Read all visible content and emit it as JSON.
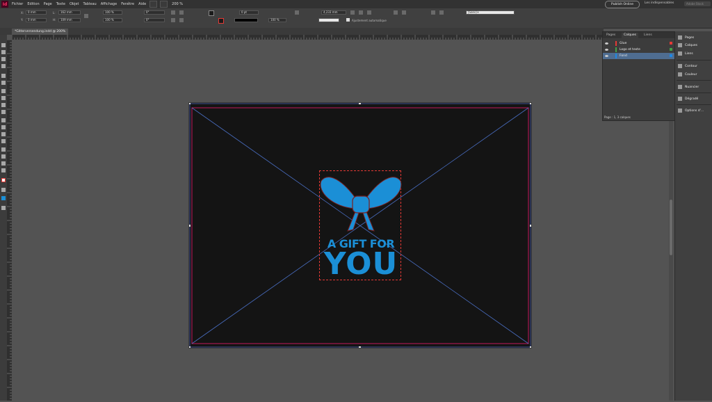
{
  "menubar": {
    "logo": "Id",
    "items": [
      "Fichier",
      "Edition",
      "Page",
      "Texte",
      "Objet",
      "Tableau",
      "Affichage",
      "Fenêtre",
      "Aide"
    ],
    "zoom": "200 %",
    "publish": "Publish Online",
    "workspace": "Les indispensables",
    "search_placeholder": "Adobe Stock"
  },
  "control": {
    "x": "0 mm",
    "y": "0 mm",
    "w": "162 mm",
    "h": "109 mm",
    "scale_x": "100 %",
    "scale_y": "100 %",
    "angle": "0°",
    "shear": "0°",
    "stroke_weight": "0 pt",
    "zoom_frame": "100 %",
    "offset": "4,233 mm",
    "autofit": "Ajustement automatique",
    "style": "[Sans]+"
  },
  "document_tab": "*Gitterversendung.indd @ 200%",
  "artwork": {
    "line1": "A GIFT FOR",
    "line2": "YOU",
    "color": "#1b8fd6"
  },
  "layers_panel": {
    "tabs": [
      "Pages",
      "Calques",
      "Liens"
    ],
    "active_tab": "Calques",
    "layers": [
      {
        "name": "Glue",
        "color": "#e53935"
      },
      {
        "name": "Logo et texte",
        "color": "#43a047"
      },
      {
        "name": "Fond",
        "color": "#1e88e5"
      }
    ],
    "footer": "Page : 1, 3 calques"
  },
  "dock": {
    "group1": [
      "Pages",
      "Calques",
      "Liens"
    ],
    "group2": [
      "Contour",
      "Couleur"
    ],
    "group3": [
      "Nuancier"
    ],
    "group4": [
      "Dégradé"
    ],
    "group5": [
      "Options d'..."
    ]
  }
}
